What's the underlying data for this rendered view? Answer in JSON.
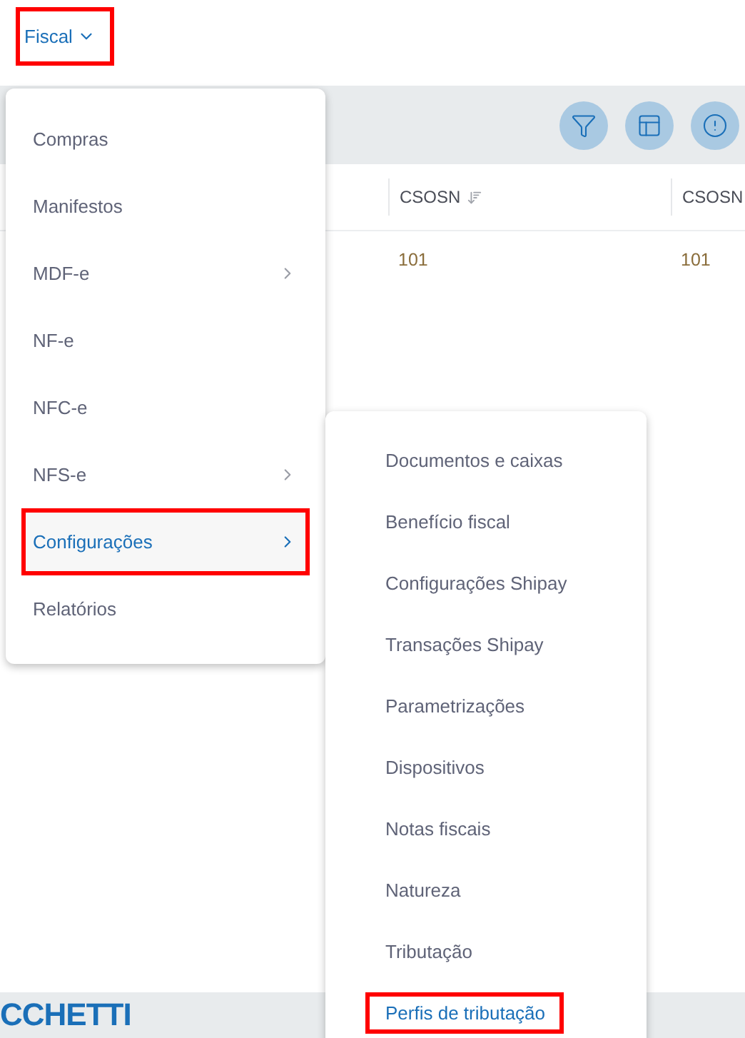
{
  "nav": {
    "label": "Fiscal",
    "highlighted": true
  },
  "table": {
    "columns": [
      {
        "label": "CSOSN",
        "sorted": true
      },
      {
        "label": "CSOSN"
      }
    ],
    "rows": [
      [
        "101",
        "101"
      ]
    ]
  },
  "menu": {
    "items": [
      {
        "label": "Compras",
        "has_submenu": false,
        "selected": false,
        "highlighted": false
      },
      {
        "label": "Manifestos",
        "has_submenu": false,
        "selected": false,
        "highlighted": false
      },
      {
        "label": "MDF-e",
        "has_submenu": true,
        "selected": false,
        "highlighted": false
      },
      {
        "label": "NF-e",
        "has_submenu": false,
        "selected": false,
        "highlighted": false
      },
      {
        "label": "NFC-e",
        "has_submenu": false,
        "selected": false,
        "highlighted": false
      },
      {
        "label": "NFS-e",
        "has_submenu": true,
        "selected": false,
        "highlighted": false
      },
      {
        "label": "Configurações",
        "has_submenu": true,
        "selected": true,
        "highlighted": true
      },
      {
        "label": "Relatórios",
        "has_submenu": false,
        "selected": false,
        "highlighted": false
      }
    ]
  },
  "submenu": {
    "items": [
      {
        "label": "Documentos e caixas",
        "selected": false,
        "highlighted": false
      },
      {
        "label": "Benefício fiscal",
        "selected": false,
        "highlighted": false
      },
      {
        "label": "Configurações Shipay",
        "selected": false,
        "highlighted": false
      },
      {
        "label": "Transações Shipay",
        "selected": false,
        "highlighted": false
      },
      {
        "label": "Parametrizações",
        "selected": false,
        "highlighted": false
      },
      {
        "label": "Dispositivos",
        "selected": false,
        "highlighted": false
      },
      {
        "label": "Notas fiscais",
        "selected": false,
        "highlighted": false
      },
      {
        "label": "Natureza",
        "selected": false,
        "highlighted": false
      },
      {
        "label": "Tributação",
        "selected": false,
        "highlighted": false
      },
      {
        "label": "Perfis de tributação",
        "selected": true,
        "highlighted": true
      }
    ]
  },
  "footer": {
    "logo": "CCHETTI"
  }
}
